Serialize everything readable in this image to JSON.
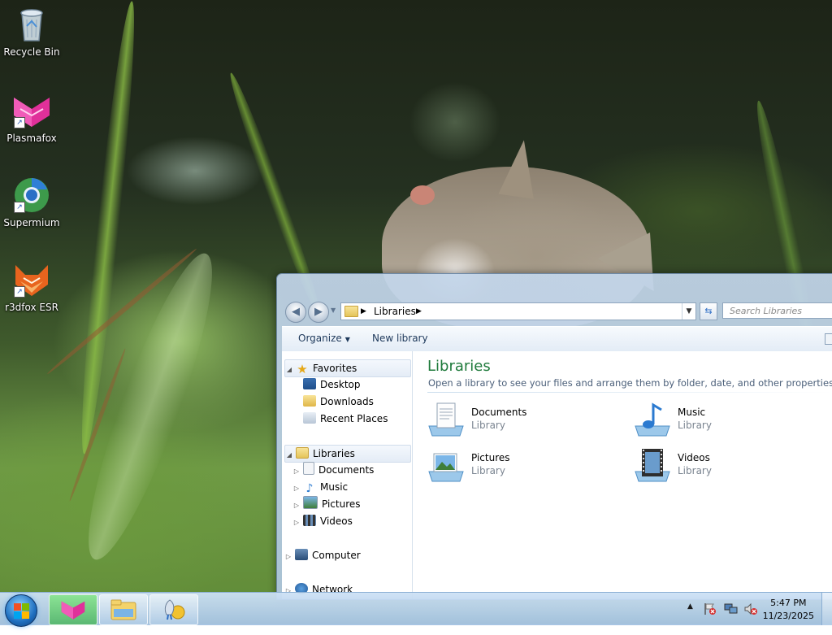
{
  "desktop": {
    "icons": [
      {
        "label": "Recycle Bin",
        "icon": "recycle-bin-icon"
      },
      {
        "label": "Plasmafox",
        "icon": "plasmafox-icon"
      },
      {
        "label": "Supermium",
        "icon": "supermium-icon"
      },
      {
        "label": "r3dfox ESR",
        "icon": "r3dfox-icon"
      }
    ]
  },
  "explorer": {
    "address": {
      "crumb": "Libraries"
    },
    "search": {
      "placeholder": "Search Libraries"
    },
    "toolbar": {
      "organize": "Organize",
      "new_library": "New library"
    },
    "nav": {
      "favorites": "Favorites",
      "desktop": "Desktop",
      "downloads": "Downloads",
      "recent_places": "Recent Places",
      "libraries": "Libraries",
      "documents": "Documents",
      "music": "Music",
      "pictures": "Pictures",
      "videos": "Videos",
      "computer": "Computer",
      "network": "Network"
    },
    "content": {
      "title": "Libraries",
      "subtitle": "Open a library to see your files and arrange them by folder, date, and other properties.",
      "libraries": [
        {
          "name": "Documents",
          "type": "Library",
          "icon": "documents-library-icon"
        },
        {
          "name": "Music",
          "type": "Library",
          "icon": "music-library-icon"
        },
        {
          "name": "Pictures",
          "type": "Library",
          "icon": "pictures-library-icon"
        },
        {
          "name": "Videos",
          "type": "Library",
          "icon": "videos-library-icon"
        }
      ]
    }
  },
  "taskbar": {
    "clock": {
      "time": "5:47 PM",
      "date": "11/23/2025"
    }
  },
  "colors": {
    "library_title": "#1e7a3b",
    "taskbar": "#b5cde6",
    "accent": "#2b6cc4"
  }
}
